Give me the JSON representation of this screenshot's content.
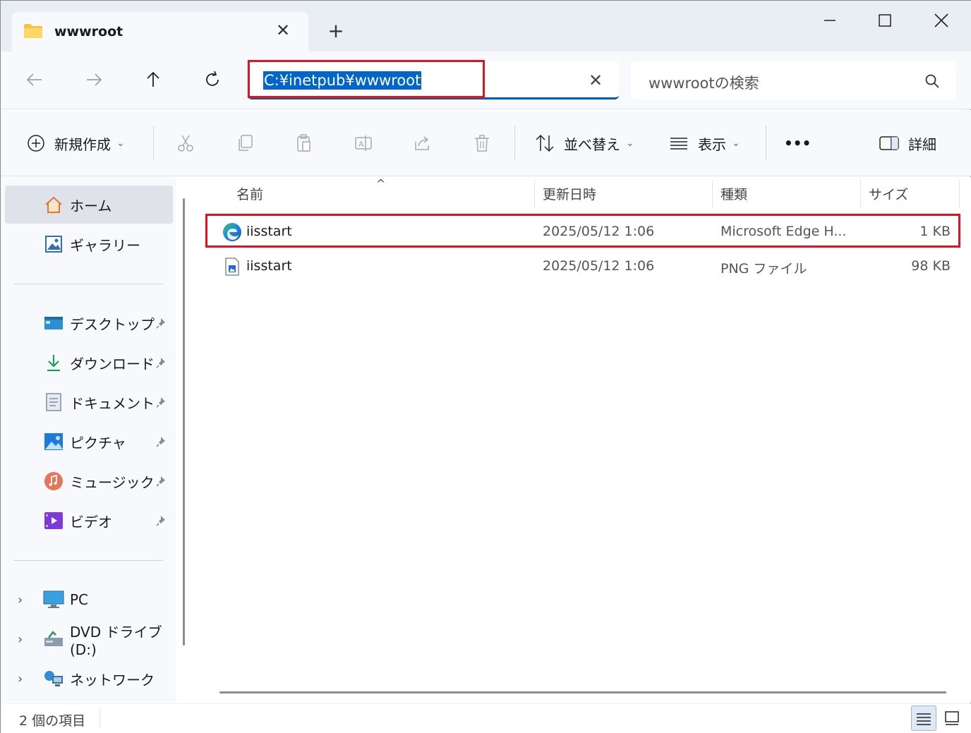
{
  "tab": {
    "title": "wwwroot",
    "close": "✕",
    "new_tab": "+"
  },
  "window_controls": {
    "minimize": "minimize",
    "maximize": "maximize",
    "close": "close"
  },
  "nav": {
    "address": "C:¥inetpub¥wwwroot",
    "address_clear": "✕",
    "search_placeholder": "wwwrootの検索"
  },
  "commands": {
    "new": "新規作成",
    "sort": "並べ替え",
    "view": "表示",
    "more": "•••",
    "details": "詳細"
  },
  "sidebar": {
    "home": "ホーム",
    "gallery": "ギャラリー",
    "pinned": [
      {
        "label": "デスクトップ",
        "icon": "desktop-icon"
      },
      {
        "label": "ダウンロード",
        "icon": "download-icon"
      },
      {
        "label": "ドキュメント",
        "icon": "document-icon"
      },
      {
        "label": "ピクチャ",
        "icon": "pictures-icon"
      },
      {
        "label": "ミュージック",
        "icon": "music-icon"
      },
      {
        "label": "ビデオ",
        "icon": "video-icon"
      }
    ],
    "drives": [
      {
        "label": "PC",
        "icon": "pc-icon"
      },
      {
        "label": "DVD ドライブ (D:)",
        "icon": "dvd-icon"
      },
      {
        "label": "ネットワーク",
        "icon": "network-icon"
      }
    ]
  },
  "columns": {
    "name": "名前",
    "modified": "更新日時",
    "type": "種類",
    "size": "サイズ"
  },
  "files": [
    {
      "name": "iisstart",
      "modified": "2025/05/12 1:06",
      "type": "Microsoft Edge H...",
      "size": "1 KB",
      "icon": "edge-html-icon"
    },
    {
      "name": "iisstart",
      "modified": "2025/05/12 1:06",
      "type": "PNG ファイル",
      "size": "98 KB",
      "icon": "png-file-icon"
    }
  ],
  "status": {
    "count": "2 個の項目"
  },
  "colors": {
    "accent": "#005fb8",
    "highlight": "#e0141e",
    "selection": "#0066cc"
  }
}
